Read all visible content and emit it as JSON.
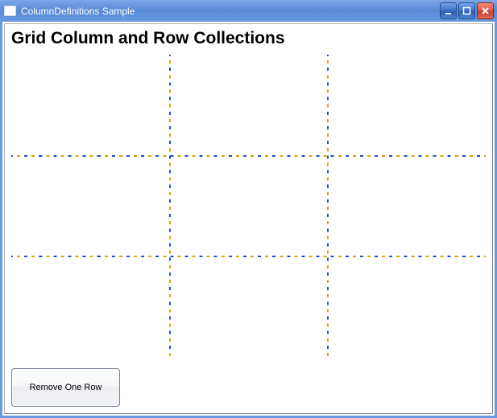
{
  "window": {
    "title": "ColumnDefinitions Sample"
  },
  "heading": "Grid Column and Row Collections",
  "button": {
    "remove_row_label": "Remove One Row"
  }
}
